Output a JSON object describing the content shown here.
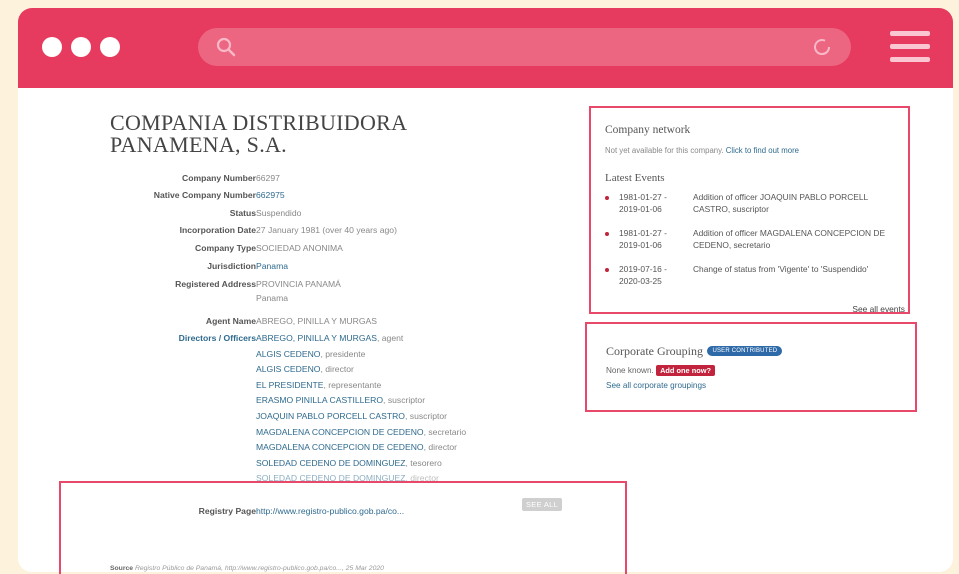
{
  "browser": {
    "search_placeholder": ""
  },
  "company": {
    "title_line1": "COMPANIA DISTRIBUIDORA",
    "title_line2": "PANAMENA, S.A.",
    "attributes": {
      "company_number_label": "Company Number",
      "company_number": "66297",
      "native_number_label": "Native Company Number",
      "native_number": "662975",
      "status_label": "Status",
      "status": "Suspendido",
      "incorporation_label": "Incorporation Date",
      "incorporation": "27 January 1981 (over 40 years ago)",
      "type_label": "Company Type",
      "type": "SOCIEDAD ANONIMA",
      "jurisdiction_label": "Jurisdiction",
      "jurisdiction": "Panama",
      "address_label": "Registered Address",
      "address_line1": "PROVINCIA PANAMÁ",
      "address_line2": "Panama",
      "agent_label": "Agent Name",
      "agent": "ABREGO, PINILLA Y MURGAS",
      "directors_label": "Directors / Officers",
      "registry_label": "Registry Page",
      "registry": "http://www.registro-publico.gob.pa/co..."
    },
    "officers": [
      {
        "name": "ABREGO, PINILLA Y MURGAS",
        "role": ", agent"
      },
      {
        "name": "ALGIS CEDENO",
        "role": ", presidente"
      },
      {
        "name": "ALGIS CEDENO",
        "role": ", director"
      },
      {
        "name": "EL PRESIDENTE",
        "role": ", representante"
      },
      {
        "name": "ERASMO PINILLA CASTILLERO",
        "role": ", suscriptor"
      },
      {
        "name": "JOAQUIN PABLO PORCELL CASTRO",
        "role": ", suscriptor"
      },
      {
        "name": "MAGDALENA CONCEPCION DE CEDENO",
        "role": ", secretario"
      },
      {
        "name": "MAGDALENA CONCEPCION DE CEDENO",
        "role": ", director"
      },
      {
        "name": "SOLEDAD CEDENO DE DOMINGUEZ",
        "role": ", tesorero"
      },
      {
        "name": "SOLEDAD CEDENO DE DOMINGUEZ",
        "role": ", director"
      }
    ],
    "see_all_label": "SEE ALL",
    "source_label": "Source",
    "source_text": "Registro Público de Panamá, http://www.registro-publico.gob.pa/co..., 25 Mar 2020"
  },
  "network": {
    "title": "Company network",
    "note": "Not yet available for this company.",
    "note_link": "Click to find out more",
    "events_title": "Latest Events",
    "events": [
      {
        "date1": "1981-01-27 -",
        "date2": "2019-01-06",
        "desc": "Addition of officer JOAQUIN PABLO PORCELL CASTRO, suscriptor"
      },
      {
        "date1": "1981-01-27 -",
        "date2": "2019-01-06",
        "desc": "Addition of officer MAGDALENA CONCEPCION DE CEDENO, secretario"
      },
      {
        "date1": "2019-07-16 -",
        "date2": "2020-03-25",
        "desc": "Change of status from 'Vigente' to 'Suspendido'"
      }
    ],
    "see_all_events": "See all events"
  },
  "grouping": {
    "title": "Corporate Grouping",
    "badge": "USER CONTRIBUTED",
    "none_known": "None known.",
    "add_one": "Add one now?",
    "see_all": "See all corporate groupings"
  },
  "colors": {
    "titlebar": "#e63b5e",
    "highlight": "#e8496b",
    "link": "#2e6a8e",
    "bullet": "#c2233d"
  }
}
